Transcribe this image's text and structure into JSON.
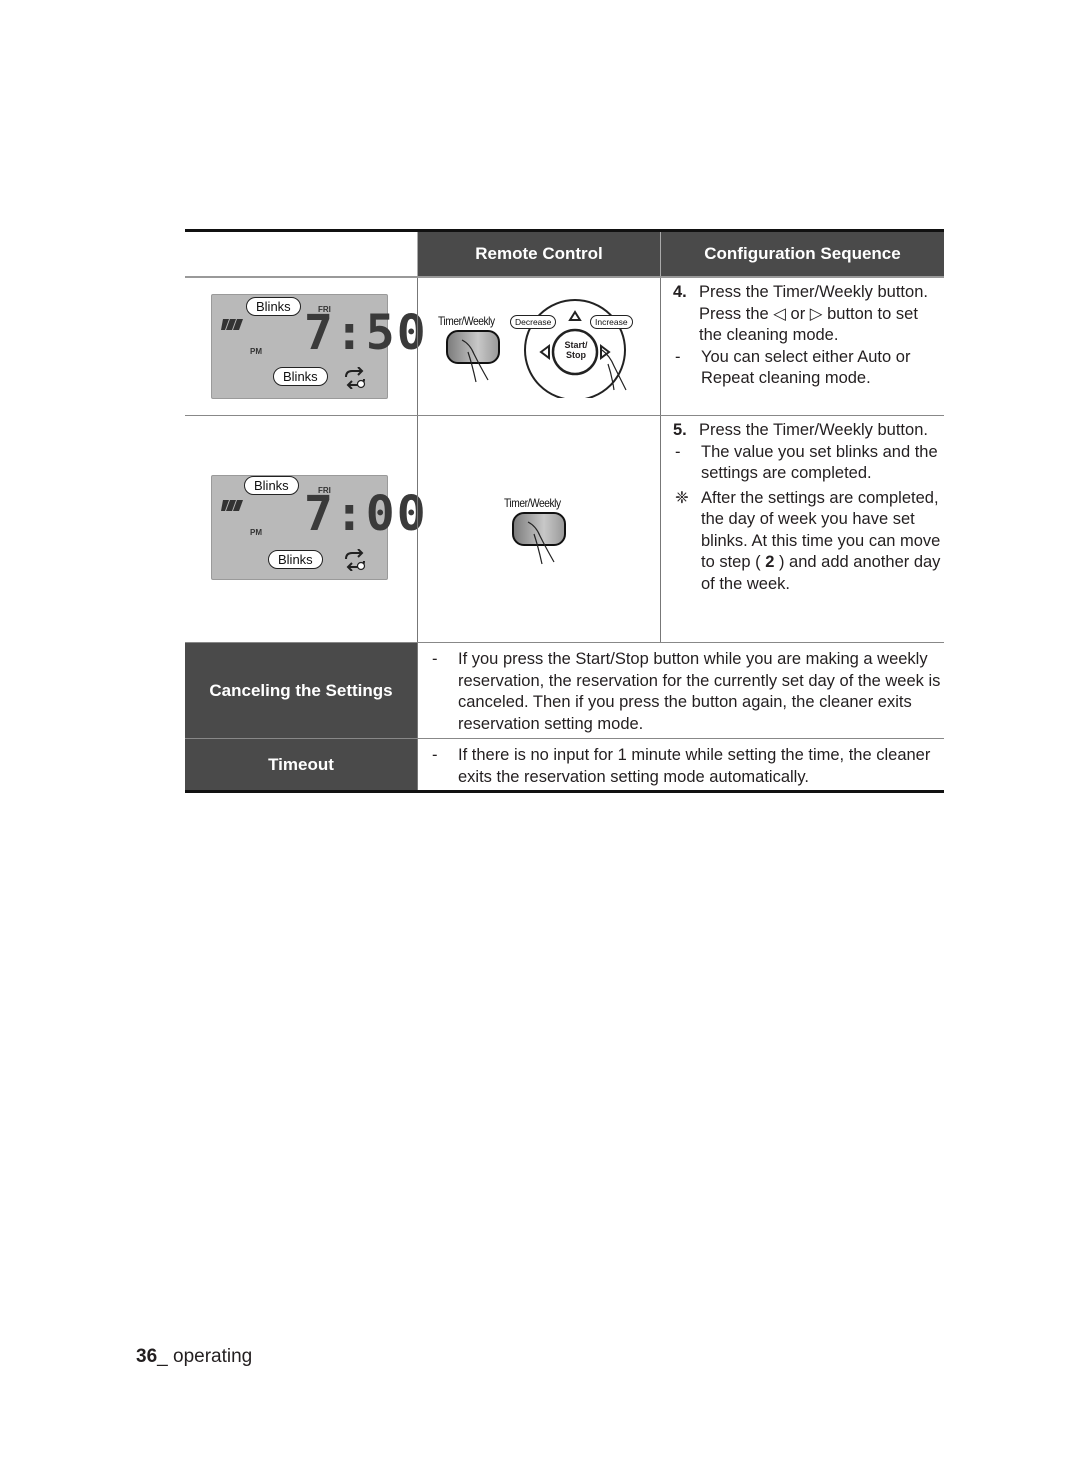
{
  "table": {
    "headers": [
      "",
      "Remote Control",
      "Configuration Sequence"
    ],
    "rows": [
      {
        "display": {
          "time": "7:50",
          "day": "FRI",
          "period": "PM",
          "callouts": [
            "Blinks",
            "Blinks"
          ]
        },
        "remote": {
          "button_label": "Timer/Weekly",
          "dial_labels": {
            "left": "Decrease",
            "right": "Increase",
            "center": "Start/ Stop"
          }
        },
        "sequence": {
          "number": "4.",
          "text": "Press the Timer/Weekly button. Press the ◁ or ▷ button to set the cleaning mode.",
          "notes": [
            {
              "bullet": "-",
              "text": "You can select either Auto or Repeat cleaning mode."
            }
          ]
        }
      },
      {
        "display": {
          "time": "7:00",
          "day": "FRI",
          "period": "PM",
          "callouts": [
            "Blinks",
            "Blinks"
          ]
        },
        "remote": {
          "button_label": "Timer/Weekly"
        },
        "sequence": {
          "number": "5.",
          "text": "Press the Timer/Weekly button.",
          "notes": [
            {
              "bullet": "-",
              "text": "The value you set blinks and the settings are completed."
            },
            {
              "bullet": "❈",
              "text_before": "After the settings are completed, the day of week you have set blinks. At this time you can move to step ( ",
              "bold": "2",
              "text_after": " ) and add another day of the week."
            }
          ]
        }
      }
    ],
    "extra_rows": [
      {
        "label": "Canceling the Settings",
        "bullet": "-",
        "text": "If you press the Start/Stop button while you are making a weekly reservation, the reservation for the currently set day of the week is canceled. Then if you press the button again, the cleaner exits reservation setting mode."
      },
      {
        "label": "Timeout",
        "bullet": "-",
        "text": "If there is no input for 1 minute while setting the time, the cleaner exits the reservation setting mode automatically."
      }
    ]
  },
  "footer": {
    "page_number": "36",
    "separator": "_ ",
    "section": "operating"
  }
}
